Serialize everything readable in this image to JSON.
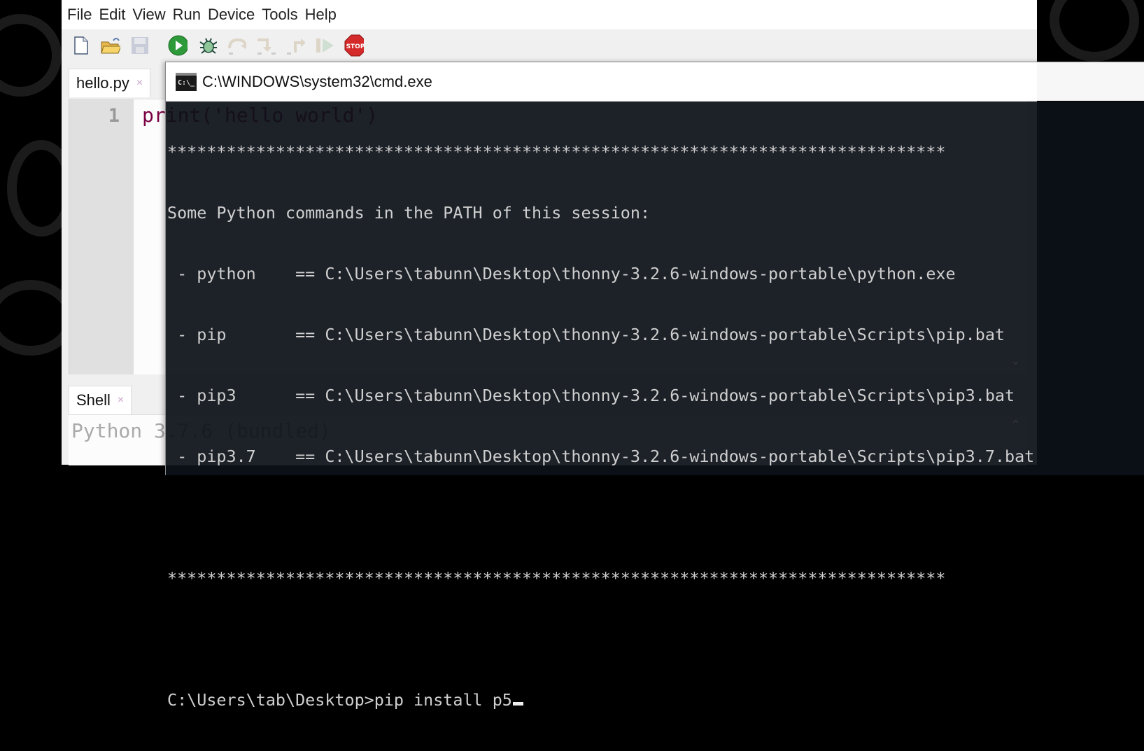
{
  "menubar": {
    "items": [
      "File",
      "Edit",
      "View",
      "Run",
      "Device",
      "Tools",
      "Help"
    ]
  },
  "toolbar": {
    "buttons": [
      {
        "name": "new-file",
        "icon": "new-file-icon",
        "enabled": true
      },
      {
        "name": "open-file",
        "icon": "open-folder-icon",
        "enabled": true
      },
      {
        "name": "save-file",
        "icon": "floppy-disk-icon",
        "enabled": false
      },
      {
        "name": "run",
        "icon": "play-icon",
        "enabled": true
      },
      {
        "name": "debug",
        "icon": "bug-icon",
        "enabled": true
      },
      {
        "name": "step-over",
        "icon": "step-over-icon",
        "enabled": false
      },
      {
        "name": "step-into",
        "icon": "step-into-icon",
        "enabled": false
      },
      {
        "name": "step-out",
        "icon": "step-out-icon",
        "enabled": false
      },
      {
        "name": "resume",
        "icon": "resume-icon",
        "enabled": false
      },
      {
        "name": "stop",
        "icon": "stop-sign-icon",
        "enabled": true,
        "label": "STOP"
      }
    ]
  },
  "editor": {
    "tab_label": "hello.py",
    "tab_close": "×",
    "line_number": "1",
    "code_line": "print('hello world')"
  },
  "shell": {
    "tab_label": "Shell",
    "tab_close": "×",
    "text": "Python 3.7.6 (bundled)"
  },
  "cmd": {
    "title": "C:\\WINDOWS\\system32\\cmd.exe",
    "icon_text": "C:\\_",
    "lines": [
      "*******************************************************************************",
      "Some Python commands in the PATH of this session:",
      " - python    == C:\\Users\\tabunn\\Desktop\\thonny-3.2.6-windows-portable\\python.exe",
      " - pip       == C:\\Users\\tabunn\\Desktop\\thonny-3.2.6-windows-portable\\Scripts\\pip.bat",
      " - pip3      == C:\\Users\\tabunn\\Desktop\\thonny-3.2.6-windows-portable\\Scripts\\pip3.bat",
      " - pip3.7    == C:\\Users\\tabunn\\Desktop\\thonny-3.2.6-windows-portable\\Scripts\\pip3.7.bat",
      "",
      "*******************************************************************************",
      "",
      "C:\\Users\\tab\\Desktop>pip install p5"
    ]
  }
}
